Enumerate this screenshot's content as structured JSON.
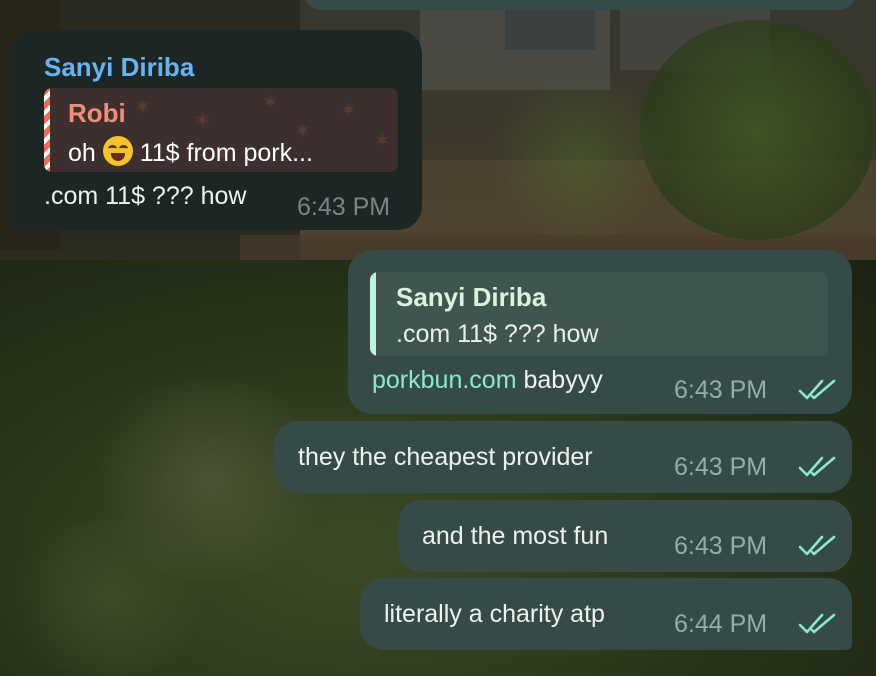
{
  "chat": {
    "incoming": {
      "sender": "Sanyi Diriba",
      "reply": {
        "name": "Robi",
        "text_before": "oh",
        "emoji_icon": "face-with-tears-of-joy-icon",
        "text_after": "11$ from pork..."
      },
      "text": ".com 11$ ??? how",
      "time": "6:43 PM"
    },
    "outgoing": [
      {
        "reply": {
          "name": "Sanyi Diriba",
          "text": ".com 11$ ??? how"
        },
        "link": "porkbun.com",
        "text": " babyyy",
        "time": "6:43 PM"
      },
      {
        "text": "they the cheapest provider",
        "time": "6:43 PM"
      },
      {
        "text": "and the most fun",
        "time": "6:43 PM"
      },
      {
        "text": "literally a charity atp",
        "time": "6:44 PM"
      }
    ]
  },
  "colors": {
    "incoming_bubble": "#1c2625",
    "outgoing_bubble": "#364b47",
    "sender_name": "#6ab3f3",
    "reply_name_pink": "#f08c7a",
    "reply_name_green": "#ddf2dd",
    "link": "#8ae8cf",
    "read_checks": "#8ae8cf"
  }
}
